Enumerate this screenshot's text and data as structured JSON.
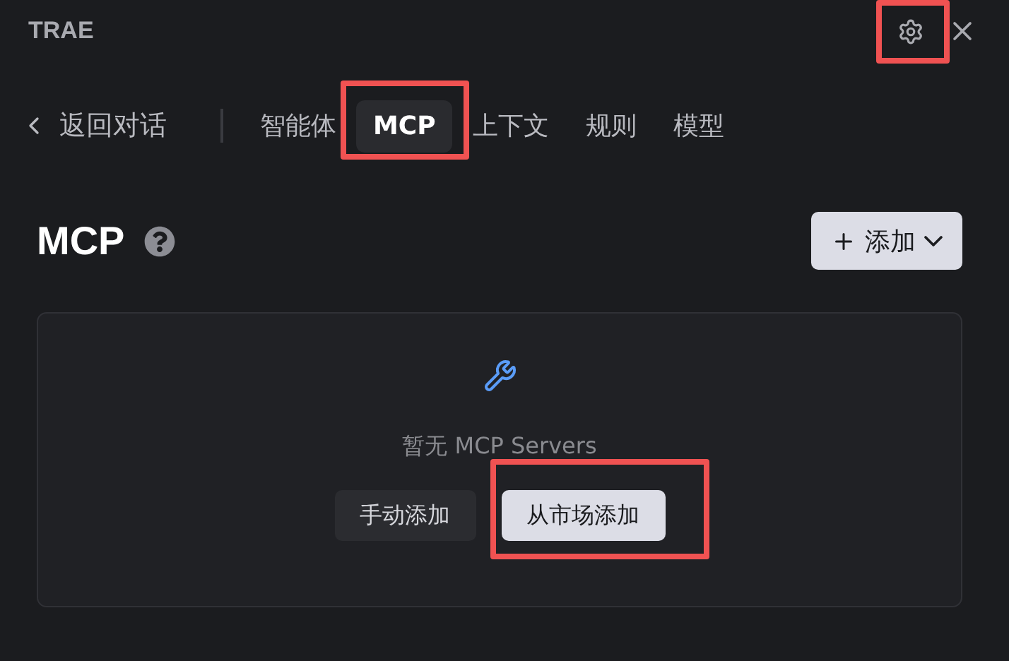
{
  "header": {
    "title": "TRAE",
    "settings_highlighted": true
  },
  "nav": {
    "back": "返回对话",
    "tabs": [
      {
        "label": "智能体",
        "selected": false,
        "highlighted": false
      },
      {
        "label": "MCP",
        "selected": true,
        "highlighted": true
      },
      {
        "label": "上下文",
        "selected": false,
        "highlighted": false
      },
      {
        "label": "规则",
        "selected": false,
        "highlighted": false
      },
      {
        "label": "模型",
        "selected": false,
        "highlighted": false
      }
    ]
  },
  "section": {
    "title": "MCP",
    "add_button": "添加"
  },
  "empty_state": {
    "message": "暂无 MCP Servers",
    "buttons": [
      {
        "label": "手动添加",
        "kind": "secondary",
        "highlighted": false
      },
      {
        "label": "从市场添加",
        "kind": "primary",
        "highlighted": true
      }
    ]
  }
}
